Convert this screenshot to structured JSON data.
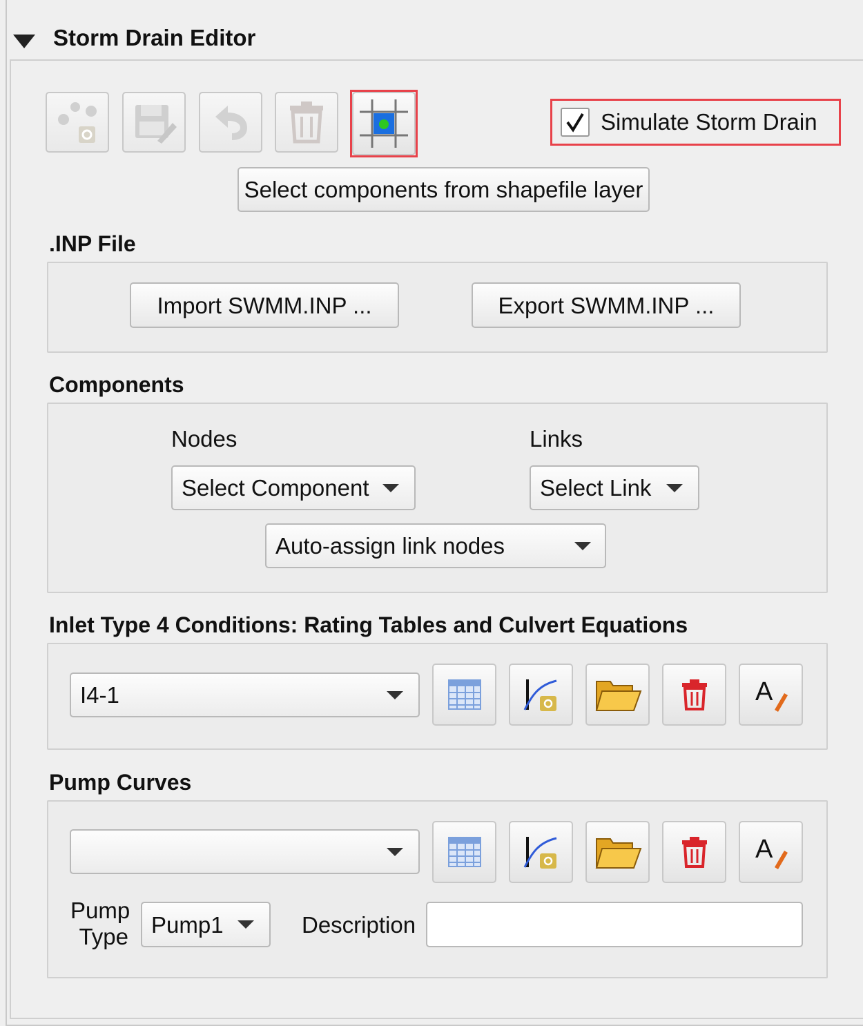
{
  "panel": {
    "title": "Storm Drain Editor",
    "collapse_icon": "triangle-down-icon"
  },
  "toolbar": {
    "buttons": [
      {
        "icon": "nodes-gear-icon",
        "enabled": false
      },
      {
        "icon": "save-edit-icon",
        "enabled": false
      },
      {
        "icon": "undo-icon",
        "enabled": false
      },
      {
        "icon": "trash-icon",
        "enabled": false
      },
      {
        "icon": "grid-select-icon",
        "enabled": true,
        "highlighted": true
      }
    ],
    "simulate_checkbox": {
      "label": "Simulate Storm Drain",
      "checked": true
    },
    "select_components_label": "Select components from shapefile layer"
  },
  "inp_file": {
    "heading": ".INP File",
    "import_label": "Import SWMM.INP ...",
    "export_label": "Export SWMM.INP ..."
  },
  "components": {
    "heading": "Components",
    "nodes_label": "Nodes",
    "links_label": "Links",
    "nodes_select": "Select Component",
    "links_select": "Select Link",
    "auto_assign_select": "Auto-assign link nodes"
  },
  "inlet_type4": {
    "heading": "Inlet Type 4 Conditions: Rating Tables and Culvert Equations",
    "selected": "I4-1",
    "actions": [
      "table-icon",
      "curve-add-icon",
      "folder-open-icon",
      "delete-icon",
      "rename-icon"
    ]
  },
  "pump_curves": {
    "heading": "Pump Curves",
    "selected": "",
    "actions": [
      "table-icon",
      "curve-add-icon",
      "folder-open-icon",
      "delete-icon",
      "rename-icon"
    ],
    "pump_type_label_line1": "Pump",
    "pump_type_label_line2": "Type",
    "pump_type_value": "Pump1",
    "description_label": "Description",
    "description_value": ""
  },
  "colors": {
    "highlight": "#e8424a",
    "background": "#efefef",
    "icon_blue": "#1a6fe0",
    "icon_green": "#2ec81e"
  }
}
